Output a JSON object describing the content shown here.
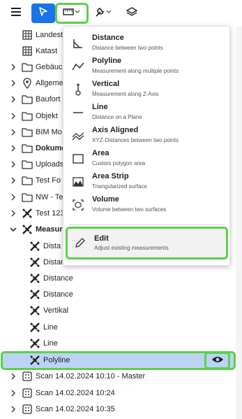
{
  "toolbar": {
    "menu_icon": "hamburger-icon",
    "select_icon": "cursor-icon",
    "measure_icon": "ruler-icon",
    "tools_icon": "wrench-icon",
    "layers_icon": "layers-icon"
  },
  "tree": {
    "items": [
      {
        "label": "Landest",
        "icon": "grid-icon",
        "chevron": false
      },
      {
        "label": "Katast",
        "icon": "grid-icon",
        "chevron": false
      },
      {
        "label": "Gebäuc",
        "icon": "folder-icon",
        "chevron": true
      },
      {
        "label": "Allgeme",
        "icon": "pin-icon",
        "chevron": true
      },
      {
        "label": "Baufort",
        "icon": "folder-icon",
        "chevron": true
      },
      {
        "label": "Objekt",
        "icon": "folder-icon",
        "chevron": true
      },
      {
        "label": "BIM Mo",
        "icon": "folder-icon",
        "chevron": true
      },
      {
        "label": "Dokume",
        "icon": "folder-icon",
        "chevron": true
      },
      {
        "label": "Uploads",
        "icon": "folder-icon",
        "chevron": true
      },
      {
        "label": "Test Fo",
        "icon": "folder-icon",
        "chevron": true
      },
      {
        "label": "NW - Te",
        "icon": "folder-icon",
        "chevron": true
      },
      {
        "label": "Test 123",
        "icon": "measure-icon",
        "chevron": true
      },
      {
        "label": "Measure",
        "icon": "measure-icon",
        "chevron": true
      },
      {
        "label": "Dista",
        "icon": "measure-icon",
        "chevron": false
      },
      {
        "label": "Distance",
        "icon": "measure-icon",
        "chevron": false
      },
      {
        "label": "Distance",
        "icon": "measure-icon",
        "chevron": false
      },
      {
        "label": "Distance",
        "icon": "measure-icon",
        "chevron": false
      },
      {
        "label": "Vertikal",
        "icon": "measure-icon",
        "chevron": false
      },
      {
        "label": "Line",
        "icon": "measure-icon",
        "chevron": false
      },
      {
        "label": "Line",
        "icon": "measure-icon",
        "chevron": false
      },
      {
        "label": "Polyline",
        "icon": "measure-icon",
        "chevron": false
      },
      {
        "label": "Scan 14.02.2024 10:10 - Master",
        "icon": "scan-icon",
        "chevron": true
      },
      {
        "label": "Scan 14.02.2024 10:24",
        "icon": "scan-icon",
        "chevron": true
      },
      {
        "label": "Scan 14.02.2024 10:35",
        "icon": "scan-icon",
        "chevron": true
      }
    ]
  },
  "menu": {
    "items": [
      {
        "title": "Distance",
        "desc": "Distance between two points",
        "icon": "angle-icon"
      },
      {
        "title": "Polyline",
        "desc": "Measurement along multiple points",
        "icon": "polyline-icon"
      },
      {
        "title": "Vertical",
        "desc": "Measurement along Z-Axis",
        "icon": "vertical-icon"
      },
      {
        "title": "Line",
        "desc": "Distance on a Plane",
        "icon": "line-icon"
      },
      {
        "title": "Axis Aligned",
        "desc": "XYZ-Distances between two points",
        "icon": "axis-icon"
      },
      {
        "title": "Area",
        "desc": "Custom polygon area",
        "icon": "area-icon"
      },
      {
        "title": "Area Strip",
        "desc": "Triangularized surface",
        "icon": "area-strip-icon"
      },
      {
        "title": "Volume",
        "desc": "Volume between two surfaces",
        "icon": "volume-icon"
      }
    ],
    "edit": {
      "title": "Edit",
      "desc": "Adjust existing measurements",
      "icon": "pencil-icon"
    }
  },
  "colors": {
    "accent": "#1a73e8",
    "highlight": "#5bd14a",
    "selected": "#bcd3f5"
  }
}
